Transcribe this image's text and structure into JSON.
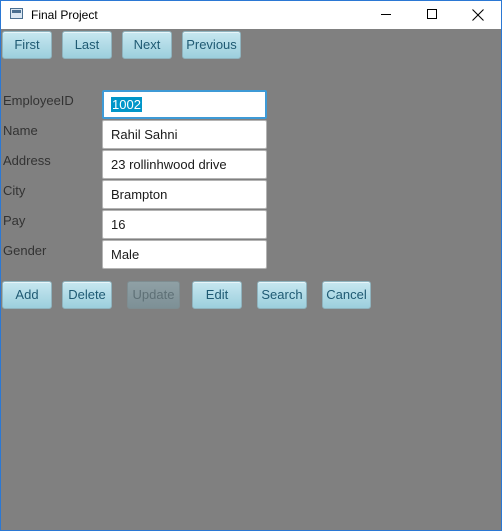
{
  "window": {
    "title": "Final Project",
    "controls": [
      "minimize-icon",
      "maximize-icon",
      "close-icon"
    ]
  },
  "nav_buttons": {
    "first": "First",
    "last": "Last",
    "next": "Next",
    "previous": "Previous"
  },
  "form": {
    "employee_id": {
      "label": "EmployeeID",
      "value": "1002",
      "selected": true
    },
    "name": {
      "label": "Name",
      "value": "Rahil Sahni"
    },
    "address": {
      "label": "Address",
      "value": "23 rollinhwood drive"
    },
    "city": {
      "label": "City",
      "value": "Brampton"
    },
    "pay": {
      "label": "Pay",
      "value": "16"
    },
    "gender": {
      "label": "Gender",
      "value": "Male"
    }
  },
  "action_buttons": {
    "add": "Add",
    "delete": "Delete",
    "update": "Update",
    "edit": "Edit",
    "search": "Search",
    "cancel": "Cancel"
  },
  "colors": {
    "background": "#808080",
    "button_top": "#c7e7f0",
    "button_bottom": "#9ccfdd",
    "button_text": "#1f5a73",
    "focus_border": "#3e9ad6",
    "selection": "#0096c9",
    "window_border": "#2b78d4"
  }
}
